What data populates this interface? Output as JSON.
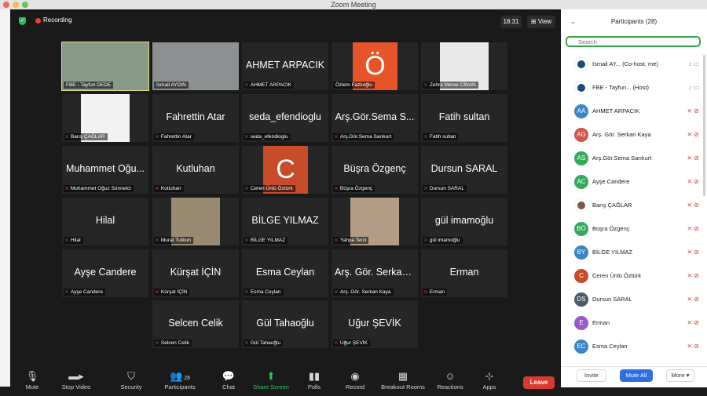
{
  "window": {
    "title": "Zoom Meeting",
    "traffic": [
      "#ec6a5e",
      "#f4bf4f",
      "#61c554"
    ]
  },
  "topbar": {
    "recording": "Recording",
    "time": "18:31",
    "view": "View"
  },
  "tiles": [
    {
      "big": "",
      "caption": "FBE - Tayfun DEDE",
      "photo": "#8a9a88",
      "active": true,
      "mic_off": false
    },
    {
      "big": "",
      "caption": "İsmail AYDIN",
      "photo": "#8d9091",
      "mic_off": false
    },
    {
      "big": "AHMET ARPACIK",
      "caption": "AHMET ARPACIK",
      "mic_off": true
    },
    {
      "big": "",
      "caption": "Özlem Fazlıoğlu",
      "letter": "Ö",
      "letter_bg": "#e8542a",
      "mic_off": false
    },
    {
      "big": "",
      "caption": "Zehra Merve CİNAN",
      "photo": "#e9e9e9",
      "mic_off": true
    },
    {
      "big": "",
      "caption": "Barış ÇAĞLAR",
      "photo": "#f2f2f2",
      "mic_off": true
    },
    {
      "big": "Fahrettin Atar",
      "caption": "Fahrettin Atar",
      "mic_off": true
    },
    {
      "big": "seda_efendioglu",
      "caption": "seda_efendioglu",
      "mic_off": true
    },
    {
      "big": "Arş.Gör.Sema S...",
      "caption": "Arş.Gör.Sema Sarıkurt",
      "mic_off": true
    },
    {
      "big": "Fatih sultan",
      "caption": "Fatih sultan",
      "mic_off": true
    },
    {
      "big": "Muhammet Oğu...",
      "caption": "Muhammet Oğuz Sünnetci",
      "mic_off": true
    },
    {
      "big": "Kutluhan",
      "caption": "Kutluhan",
      "mic_off": true
    },
    {
      "big": "",
      "caption": "Ceren Ünlü Öztürk",
      "letter": "C",
      "letter_bg": "#c84b2a",
      "mic_off": true
    },
    {
      "big": "Büşra Özgenç",
      "caption": "Büşra Özgenç",
      "mic_off": true
    },
    {
      "big": "Dursun SARAL",
      "caption": "Dursun SARAL",
      "mic_off": true
    },
    {
      "big": "Hilal",
      "caption": "Hilal",
      "mic_off": true
    },
    {
      "big": "",
      "caption": "Murat Tutkun",
      "photo": "#9b8a72",
      "mic_off": true
    },
    {
      "big": "BİLGE  YILMAZ",
      "caption": "BİLGE  YILMAZ",
      "mic_off": true
    },
    {
      "big": "",
      "caption": "Yahya Terzi",
      "photo": "#b39b86",
      "mic_off": true
    },
    {
      "big": "gül imamoğlu",
      "caption": "gül imamoğlu",
      "mic_off": true
    },
    {
      "big": "Ayşe Candere",
      "caption": "Ayşe Candere",
      "mic_off": true
    },
    {
      "big": "Kürşat İÇİN",
      "caption": "Kürşat İÇİN",
      "mic_off": true
    },
    {
      "big": "Esma Ceylan",
      "caption": "Esma Ceylan",
      "mic_off": true
    },
    {
      "big": "Arş. Gör. Serkan...",
      "caption": "Arş. Gör. Serkan Kaya",
      "mic_off": true
    },
    {
      "big": "Erman",
      "caption": "Erman",
      "mic_off": true
    },
    {
      "big": "Selcen Celik",
      "caption": "Selcen Celik",
      "mic_off": true
    },
    {
      "big": "Gül Tahaoğlu",
      "caption": "Gül Tahaoğlu",
      "mic_off": true
    },
    {
      "big": "Uğur ŞEVİK",
      "caption": "Uğur ŞEVİK",
      "mic_off": true
    }
  ],
  "toolbar": {
    "mute": "Mute",
    "stop_video": "Stop Video",
    "security": "Security",
    "participants": "Participants",
    "participants_count": "28",
    "chat": "Chat",
    "share_screen": "Share Screen",
    "polls": "Polls",
    "record": "Record",
    "breakout_rooms": "Breakout Rooms",
    "reactions": "Reactions",
    "apps": "Apps",
    "leave": "Leave"
  },
  "panel": {
    "title": "Participants (28)",
    "search_placeholder": "Search",
    "invite": "Invite",
    "mute_all": "Mute All",
    "more": "More"
  },
  "participants": [
    {
      "initials": "",
      "name": "İsmail AY... (Co-host, me)",
      "color": "#1d4a7a",
      "muted": false
    },
    {
      "initials": "",
      "name": "FBE - Tayfun... (Host)",
      "color": "#1d4a7a",
      "muted": false
    },
    {
      "initials": "AA",
      "name": "AHMET ARPACIK",
      "color": "#3a86c8",
      "muted": true
    },
    {
      "initials": "AG",
      "name": "Arş. Gör. Serkan Kaya",
      "color": "#d2554a",
      "muted": true
    },
    {
      "initials": "AS",
      "name": "Arş.Gör.Sema Sarıkurt",
      "color": "#35a85c",
      "muted": true
    },
    {
      "initials": "AC",
      "name": "Ayşe Candere",
      "color": "#35a85c",
      "muted": true
    },
    {
      "initials": "",
      "name": "Barış ÇAĞLAR",
      "color": "#7a5a48",
      "muted": true
    },
    {
      "initials": "BÖ",
      "name": "Büşra Özgenç",
      "color": "#35a85c",
      "muted": true
    },
    {
      "initials": "BY",
      "name": "BİLGE  YILMAZ",
      "color": "#3a86c8",
      "muted": true
    },
    {
      "initials": "C",
      "name": "Ceren Ünlü Öztürk",
      "color": "#c84b2a",
      "muted": true
    },
    {
      "initials": "DS",
      "name": "Dursun SARAL",
      "color": "#4a5a6a",
      "muted": true
    },
    {
      "initials": "E",
      "name": "Erman",
      "color": "#9a5ac8",
      "muted": true
    },
    {
      "initials": "EC",
      "name": "Esma Ceylan",
      "color": "#3a86c8",
      "muted": true
    }
  ]
}
